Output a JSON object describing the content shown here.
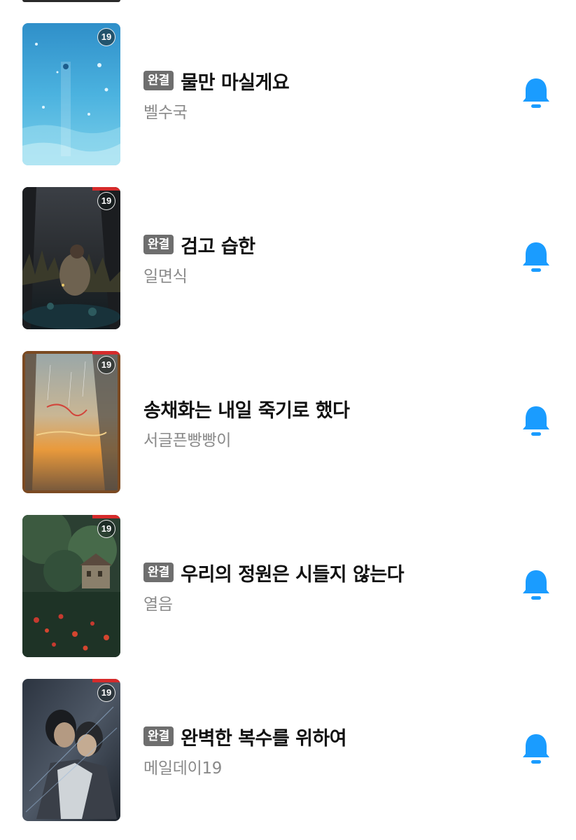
{
  "accent_color": "#1a9cff",
  "books": [
    {
      "title": "물만 마실게요",
      "author": "벨수국",
      "status": "완결",
      "age_rating": "19",
      "cover": "ocean-water"
    },
    {
      "title": "검고 습한",
      "author": "일면식",
      "status": "완결",
      "age_rating": "19",
      "cover": "dark-forest"
    },
    {
      "title": "송채화는 내일 죽기로 했다",
      "author": "서글픈빵빵이",
      "status": "",
      "age_rating": "19",
      "cover": "sunset-rain"
    },
    {
      "title": "우리의 정원은 시들지 않는다",
      "author": "열음",
      "status": "완결",
      "age_rating": "19",
      "cover": "green-garden"
    },
    {
      "title": "완벽한 복수를 위하여",
      "author": "메일데이19",
      "status": "완결",
      "age_rating": "19",
      "cover": "dark-couple"
    }
  ]
}
